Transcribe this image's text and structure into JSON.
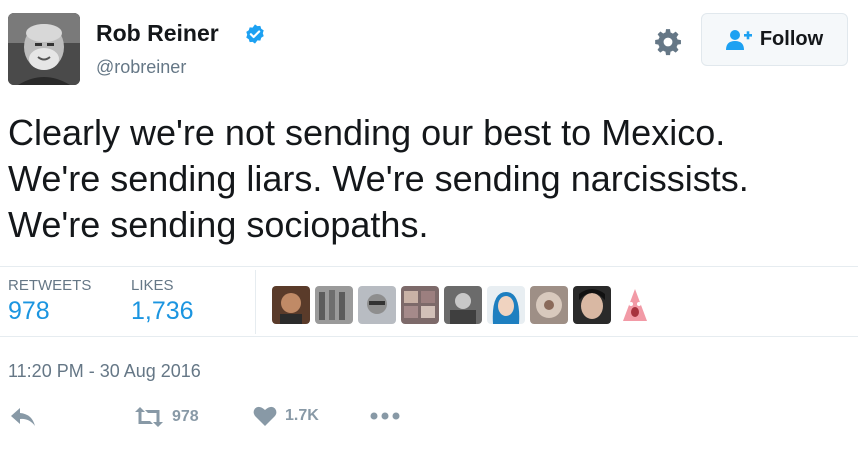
{
  "tweet": {
    "author_name": "Rob Reiner",
    "author_handle": "@robreiner",
    "text": "Clearly we're not sending our best to Mexico.\nWe're sending liars. We're sending narcissists.\nWe're sending sociopaths.",
    "timestamp": "11:20 PM - 30 Aug 2016"
  },
  "header": {
    "follow_label": "Follow",
    "icons": {
      "verified": "verified-badge-icon",
      "settings": "gear-icon",
      "follow": "add-user-icon"
    }
  },
  "stats": {
    "retweets_label": "RETWEETS",
    "retweets_value": "978",
    "likes_label": "LIKES",
    "likes_value": "1,736"
  },
  "actions": {
    "reply": {
      "icon": "reply-icon"
    },
    "retweet": {
      "icon": "retweet-icon",
      "count": "978"
    },
    "like": {
      "icon": "heart-icon",
      "count": "1.7K"
    },
    "more": {
      "icon": "more-dots-icon"
    }
  },
  "colors": {
    "link_blue": "#1b95e0",
    "verified_blue": "#1da1f2",
    "secondary_text": "#657786",
    "action_gray": "#8899a6",
    "divider": "#e6ecf0"
  }
}
